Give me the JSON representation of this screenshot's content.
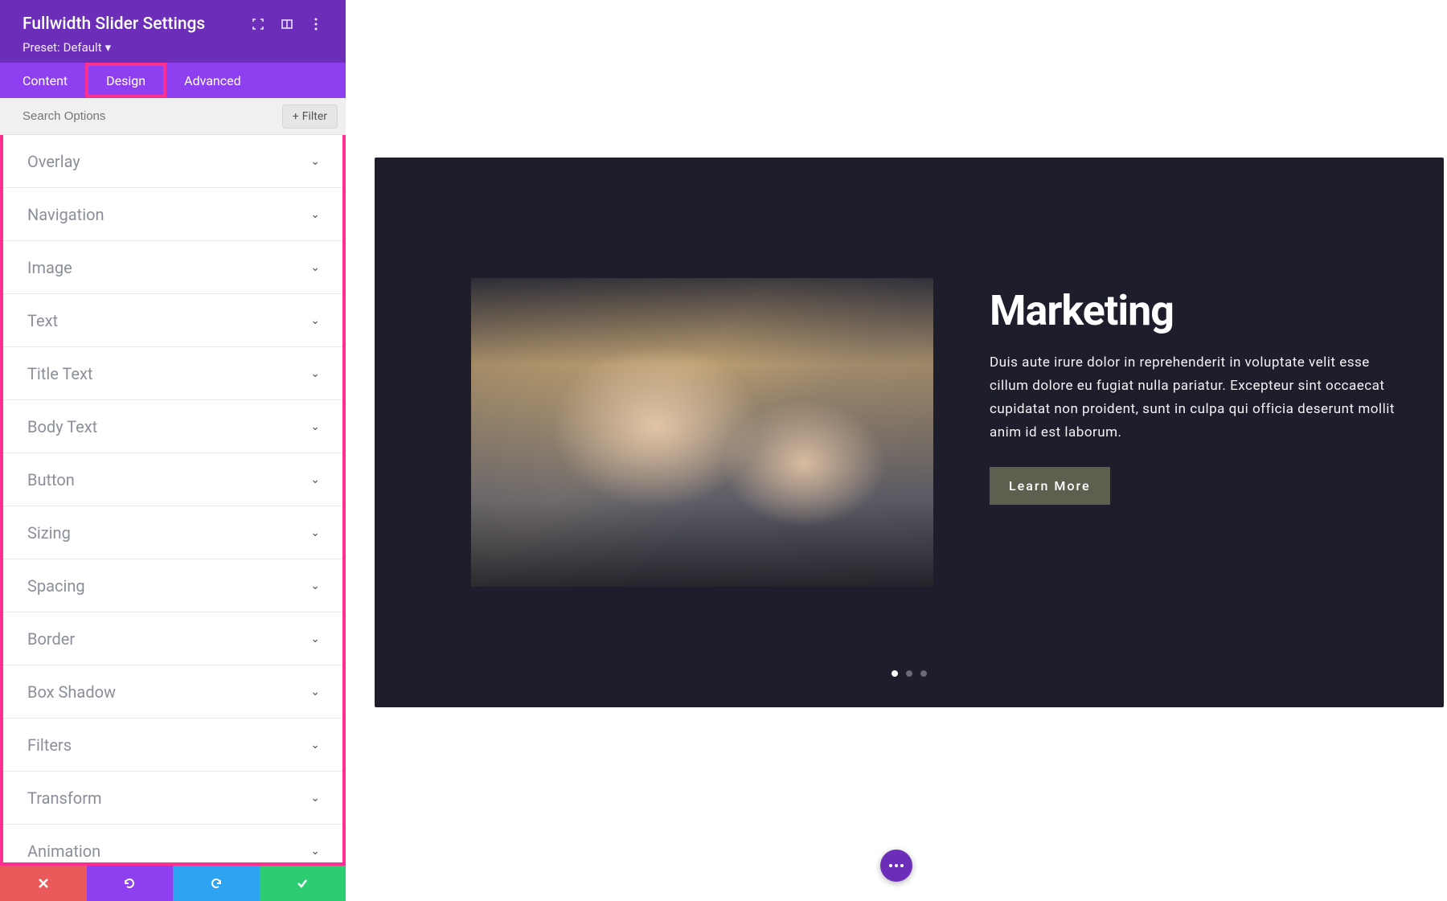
{
  "header": {
    "title": "Fullwidth Slider Settings",
    "preset_prefix": "Preset:",
    "preset_value": "Default"
  },
  "tabs": [
    {
      "label": "Content"
    },
    {
      "label": "Design"
    },
    {
      "label": "Advanced"
    }
  ],
  "search": {
    "placeholder": "Search Options",
    "filter_label": "Filter"
  },
  "options": [
    {
      "label": "Overlay"
    },
    {
      "label": "Navigation"
    },
    {
      "label": "Image"
    },
    {
      "label": "Text"
    },
    {
      "label": "Title Text"
    },
    {
      "label": "Body Text"
    },
    {
      "label": "Button"
    },
    {
      "label": "Sizing"
    },
    {
      "label": "Spacing"
    },
    {
      "label": "Border"
    },
    {
      "label": "Box Shadow"
    },
    {
      "label": "Filters"
    },
    {
      "label": "Transform"
    },
    {
      "label": "Animation"
    }
  ],
  "slide": {
    "title": "Marketing",
    "body": "Duis aute irure dolor in reprehenderit in voluptate velit esse cillum dolore eu fugiat nulla pariatur. Excepteur sint occaecat cupidatat non proident, sunt in culpa qui officia deserunt mollit anim id est laborum.",
    "button_label": "Learn More"
  },
  "dots": {
    "count": 3,
    "active": 0
  },
  "colors": {
    "header_bg": "#6c2eb9",
    "tabs_bg": "#8e3ff0",
    "highlight": "#ff2f92",
    "slider_bg": "#1d1d2b",
    "cta_bg": "#5c604e"
  }
}
